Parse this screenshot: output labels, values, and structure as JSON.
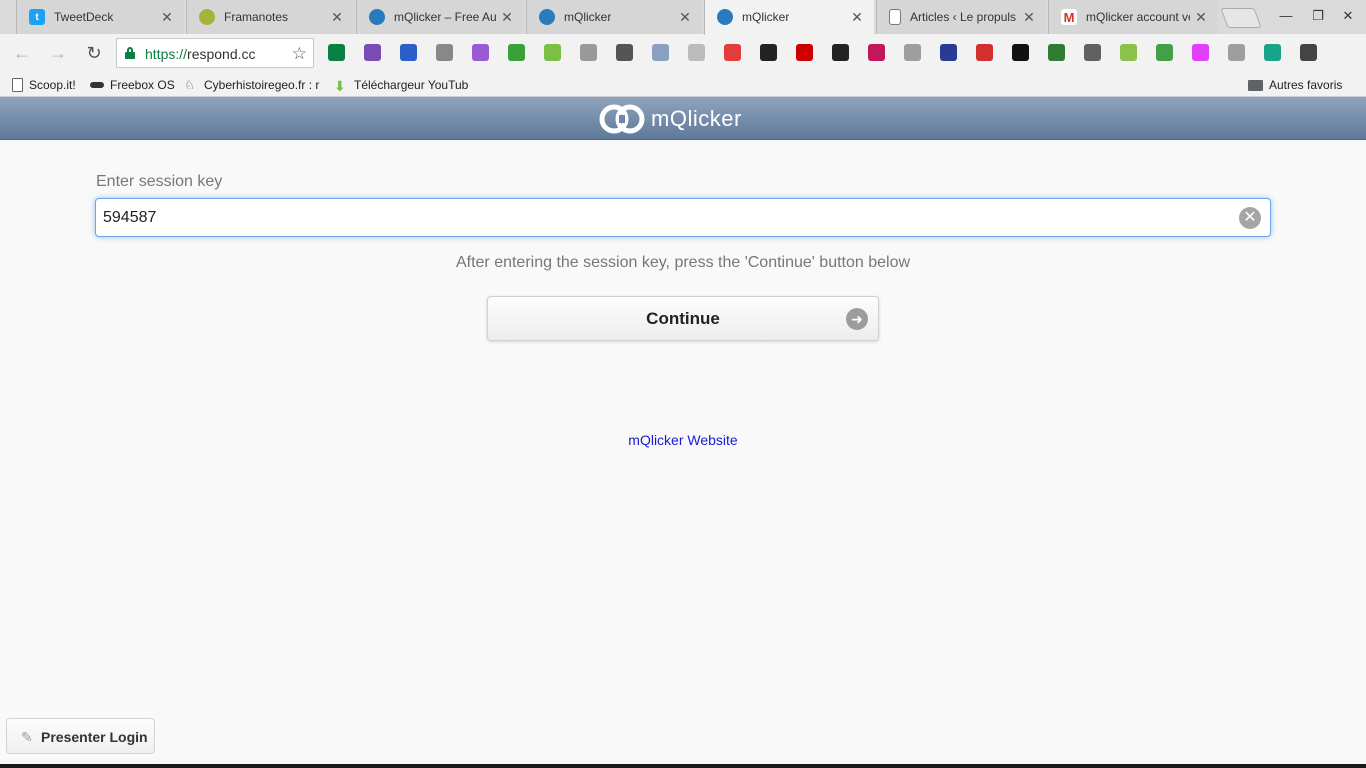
{
  "browser": {
    "tabs": [
      {
        "title": "TweetDeck",
        "icon": "twitter-icon",
        "color": "#1da1f2"
      },
      {
        "title": "Framanotes",
        "icon": "framanotes-icon",
        "color": "#a7b23b"
      },
      {
        "title": "mQlicker – Free Auc",
        "icon": "mqlicker-icon",
        "color": "#2a7bbd"
      },
      {
        "title": "mQlicker",
        "icon": "mqlicker-icon",
        "color": "#2a7bbd"
      },
      {
        "title": "mQlicker",
        "icon": "mqlicker-icon",
        "color": "#2a7bbd",
        "active": true
      },
      {
        "title": "Articles ‹ Le propuls",
        "icon": "document-icon",
        "color": "#777777"
      },
      {
        "title": "mQlicker account ve",
        "icon": "gmail-icon",
        "color": "#d93025"
      }
    ],
    "url_scheme": "https://",
    "url_host": "respond.cc",
    "bookmarks": [
      {
        "label": "Scoop.it!",
        "icon": "document-icon"
      },
      {
        "label": "Freebox OS",
        "icon": "freebox-icon"
      },
      {
        "label": "Cyberhistoiregeo.fr : r",
        "icon": "cyberhistoiregeo-icon"
      },
      {
        "label": "Téléchargeur YouTub",
        "icon": "download-icon"
      }
    ],
    "other_bookmarks": "Autres favoris",
    "extensions": [
      "#0b8043",
      "#7b4bb5",
      "#2b5ec6",
      "#888888",
      "#9b59d6",
      "#3aa03a",
      "#7ac143",
      "#999999",
      "#555555",
      "#8aa0c0",
      "#bbbbbb",
      "#e33c3c",
      "#222222",
      "#cc0000",
      "#222222",
      "#c2185b",
      "#9e9e9e",
      "#283c96",
      "#d32f2f",
      "#111111",
      "#2e7d32",
      "#616161",
      "#8bc34a",
      "#43a047",
      "#e040fb",
      "#9e9e9e",
      "#17a589",
      "#444444"
    ]
  },
  "app": {
    "logo_text": "mQlicker",
    "session_label": "Enter session key",
    "session_value": "594587",
    "hint": "After entering the session key, press the 'Continue' button below",
    "continue_label": "Continue",
    "website_link": "mQlicker Website",
    "presenter_login": "Presenter Login"
  }
}
